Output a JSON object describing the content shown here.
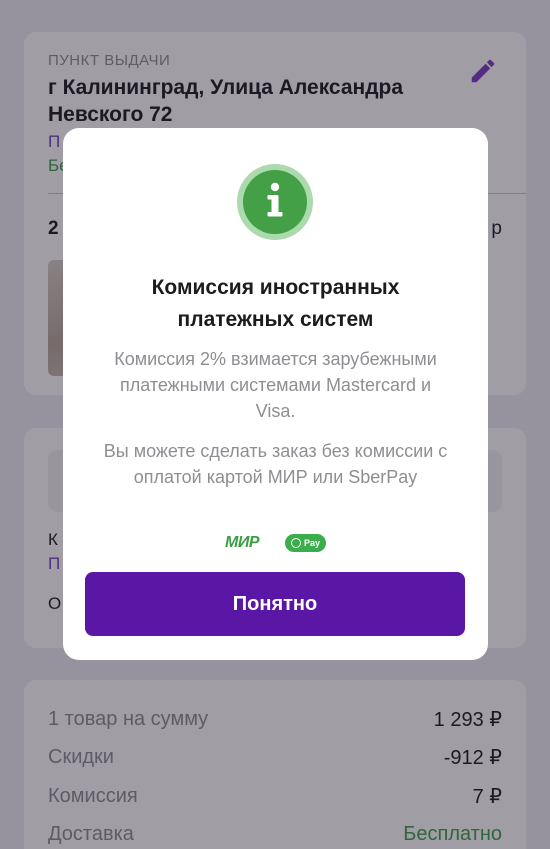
{
  "pickup": {
    "label": "ПУНКТ ВЫДАЧИ",
    "address": "г Калининград, Улица Александра Невского 72",
    "line_purple": "П",
    "line_green": "Бе",
    "row_left": "2",
    "row_right": "р"
  },
  "payment": {
    "line1": "К",
    "line2": "П",
    "line3": "О"
  },
  "summary": {
    "rows": [
      {
        "label": "1 товар на сумму",
        "value": "1 293 ₽"
      },
      {
        "label": "Скидки",
        "value": "-912 ₽"
      },
      {
        "label": "Комиссия",
        "value": "7 ₽"
      },
      {
        "label": "Доставка",
        "value": "Бесплатно"
      }
    ]
  },
  "modal": {
    "icon": "info-icon",
    "title": "Комиссия иностранных платежных систем",
    "text1": "Комиссия 2% взимается зарубежными платежными системами Mastercard и Visa.",
    "text2": "Вы можете сделать заказ без комиссии с оплатой картой МИР или SberPay",
    "mir_logo": "МИР",
    "sberpay_logo": "Pay",
    "button_label": "Понятно"
  },
  "colors": {
    "accent_purple": "#5a17a6",
    "link_purple": "#7b3fc4",
    "success_green": "#3fa04a",
    "icon_green": "#43a047"
  }
}
